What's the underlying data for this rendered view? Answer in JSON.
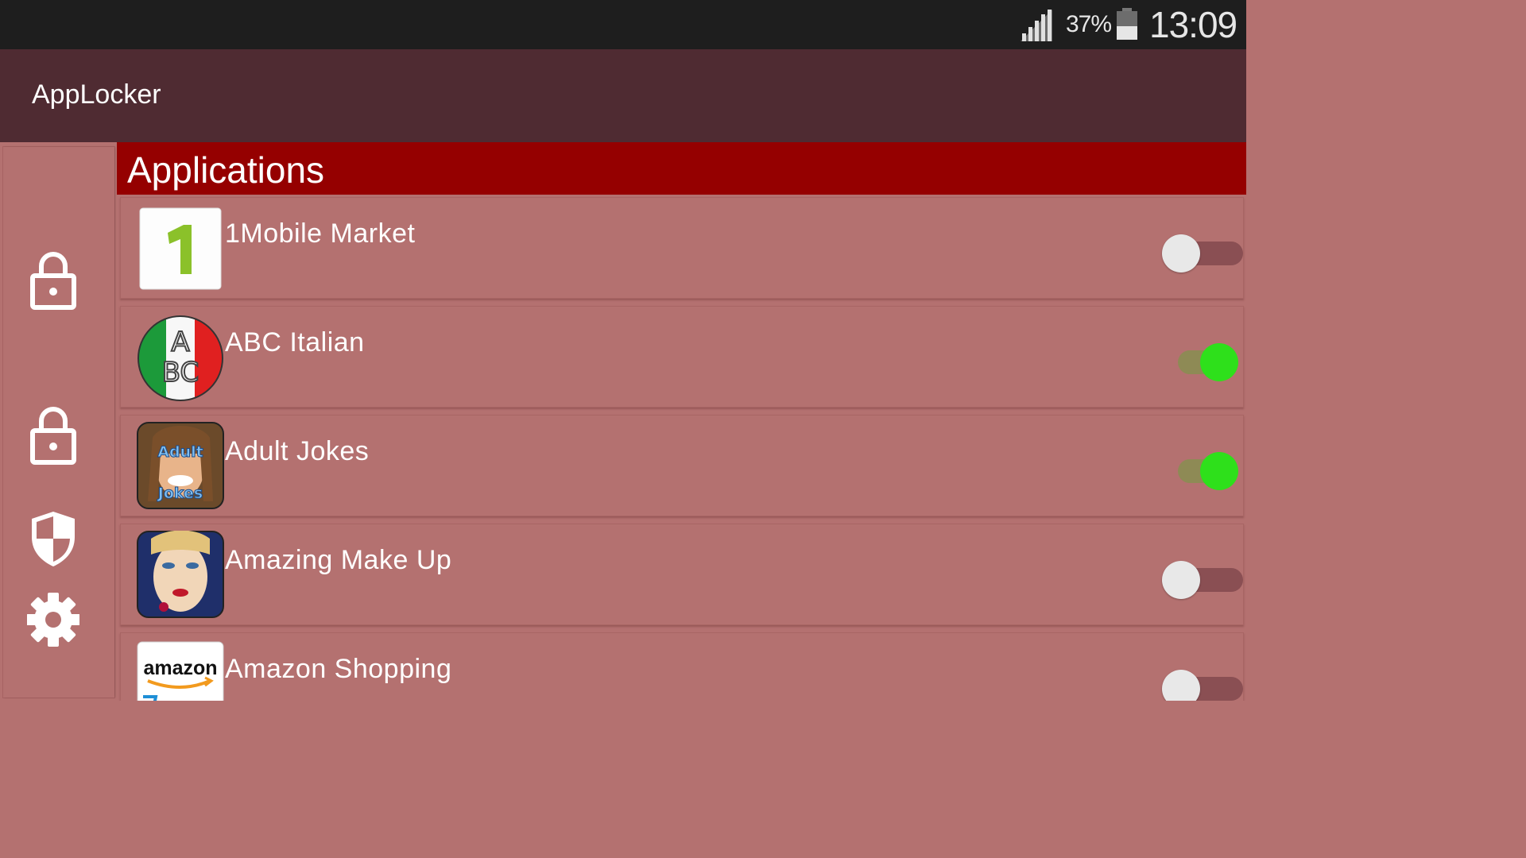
{
  "status_bar": {
    "battery_percent": "37%",
    "time": "13:09",
    "signal_icon": "signal-bars-icon",
    "battery_icon": "battery-icon"
  },
  "app_bar": {
    "title": "AppLocker"
  },
  "sidebar": {
    "items": [
      {
        "name": "locked-apps",
        "icon": "padlock-closed-icon"
      },
      {
        "name": "unlocked-apps",
        "icon": "padlock-closed-icon"
      },
      {
        "name": "protection",
        "icon": "shield-icon"
      },
      {
        "name": "settings",
        "icon": "gear-icon"
      }
    ]
  },
  "main": {
    "section_title": "Applications",
    "apps": [
      {
        "name": "1Mobile Market",
        "icon": "1mobile-market-icon",
        "locked": false
      },
      {
        "name": "ABC Italian",
        "icon": "abc-italian-icon",
        "locked": true
      },
      {
        "name": "Adult Jokes",
        "icon": "adult-jokes-icon",
        "icon_text": "Adult Jokes",
        "locked": true
      },
      {
        "name": "Amazing Make Up",
        "icon": "amazing-make-up-icon",
        "locked": false
      },
      {
        "name": "Amazon Shopping",
        "icon": "amazon-shopping-icon",
        "icon_text": "amazon",
        "locked": false
      }
    ]
  },
  "colors": {
    "status_bar": "#1e1e1e",
    "app_bar": "#4f2b32",
    "section_header": "#950000",
    "background": "#b47170",
    "toggle_on": "#2ee01b",
    "toggle_off_thumb": "#e8e8e8"
  }
}
